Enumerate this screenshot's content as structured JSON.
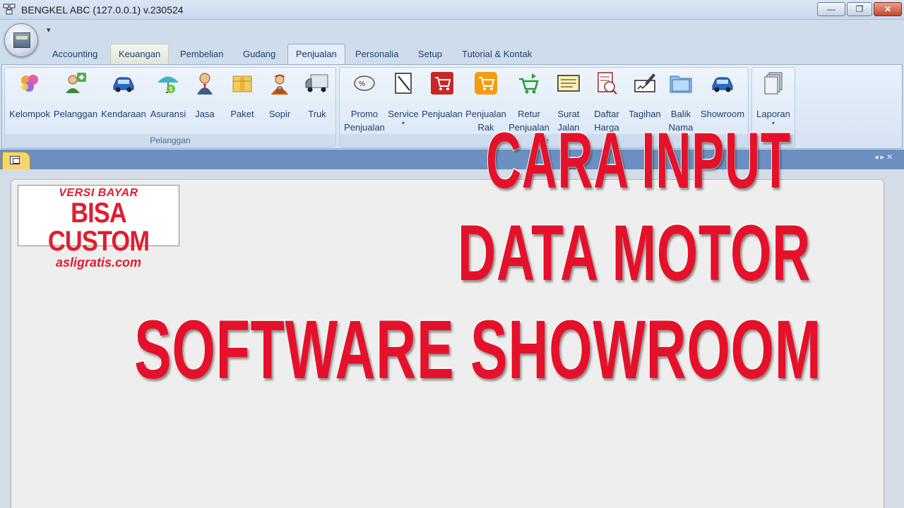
{
  "window": {
    "title": "BENGKEL ABC (127.0.0.1) v.230524",
    "min_symbol": "—",
    "max_symbol": "❐",
    "close_symbol": "✕"
  },
  "qat": {
    "symbol": "▾"
  },
  "tabs": [
    "Accounting",
    "Keuangan",
    "Pembelian",
    "Gudang",
    "Penjualan",
    "Personalia",
    "Setup",
    "Tutorial & Kontak"
  ],
  "active_tab": "Penjualan",
  "ribbon": {
    "group_pelanggan": {
      "label": "Pelanggan",
      "buttons": [
        "Kelompok",
        "Pelanggan",
        "Kendaraan",
        "Asuransi",
        "Jasa",
        "Paket",
        "Sopir",
        "Truk"
      ]
    },
    "group_penjualan": {
      "label": "Pe",
      "buttons": [
        {
          "l1": "Promo",
          "l2": "Penjualan"
        },
        {
          "l1": "Service",
          "l2": ""
        },
        {
          "l1": "Penjualan",
          "l2": ""
        },
        {
          "l1": "Penjualan",
          "l2": "Rak"
        },
        {
          "l1": "Retur",
          "l2": "Penjualan"
        },
        {
          "l1": "Surat",
          "l2": "Jalan"
        },
        {
          "l1": "Daftar",
          "l2": "Harga"
        },
        {
          "l1": "Tagihan",
          "l2": ""
        },
        {
          "l1": "Balik",
          "l2": "Nama"
        },
        {
          "l1": "Showroom",
          "l2": ""
        }
      ]
    },
    "group_laporan": {
      "button": "Laporan"
    }
  },
  "docstrip": {
    "nav": "◂ ▸ ✕"
  },
  "logo": {
    "top": "VERSI BAYAR",
    "middle": "BISA CUSTOM",
    "bottom": "asligratis.com"
  },
  "headline": {
    "line1": "CARA INPUT",
    "line2": "DATA MOTOR",
    "line3": "SOFTWARE SHOWROOM"
  },
  "colors": {
    "headline": "#e5112a",
    "logo_text": "#e11d2e",
    "ribbon_bg": "#dbe7f5",
    "doc_strip": "#6a8fc0"
  }
}
